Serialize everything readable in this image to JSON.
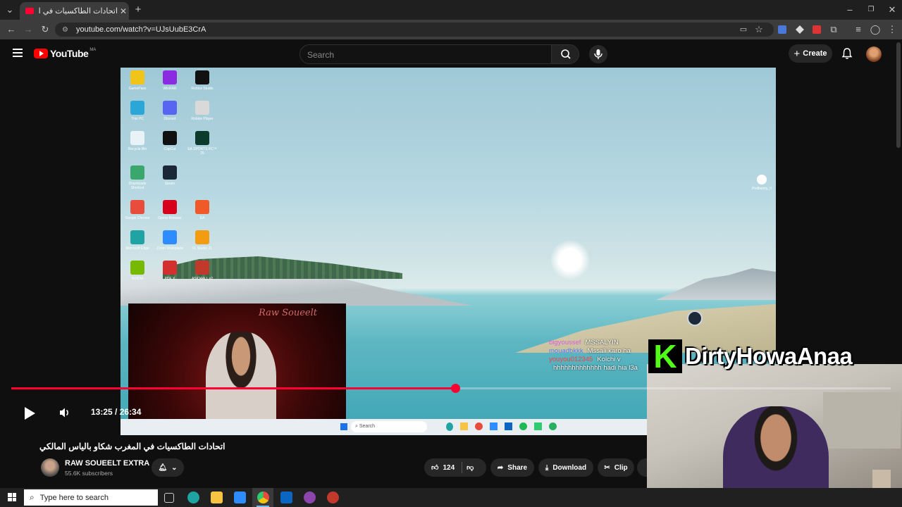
{
  "browser": {
    "tab_title": "اتحادات الطاكسيات في المغرب ...",
    "url": "youtube.com/watch?v=UJsUubE3CrA"
  },
  "youtube": {
    "logo_text": "YouTube",
    "country_code": "MA",
    "search_placeholder": "Search",
    "create_label": "Create"
  },
  "desktop": {
    "icons": [
      {
        "label": "GamePass",
        "color": "#f0c419"
      },
      {
        "label": "WinRAR",
        "color": "#8a2be2"
      },
      {
        "label": "Roblox Studio",
        "color": "#111111"
      },
      {
        "label": "This PC",
        "color": "#2aa7d8"
      },
      {
        "label": "Discord",
        "color": "#5865f2"
      },
      {
        "label": "Roblox Player",
        "color": "#d9d9d9"
      },
      {
        "label": "Recycle Bin",
        "color": "#e9f2f7"
      },
      {
        "label": "CapCut",
        "color": "#111111"
      },
      {
        "label": "EA SPORTS FC™ 25",
        "color": "#0c3b2e"
      },
      {
        "label": "Downloads Shortcut",
        "color": "#3aa76d"
      },
      {
        "label": "Steam",
        "color": "#1b2838"
      },
      {
        "label": "",
        "color": "transparent"
      },
      {
        "label": "Google Chrome",
        "color": "#e74c3c"
      },
      {
        "label": "Opera Browser",
        "color": "#d6001c"
      },
      {
        "label": "EA",
        "color": "#f05a28"
      },
      {
        "label": "Microsoft Edge",
        "color": "#1fa3a3"
      },
      {
        "label": "Zoom Workplace",
        "color": "#2d8cff"
      },
      {
        "label": "FL Studio 21",
        "color": "#f39c12"
      },
      {
        "label": "NVIDIA",
        "color": "#76b900"
      },
      {
        "label": "PDF X",
        "color": "#d32f2f"
      },
      {
        "label": "ASIO4ALL v2",
        "color": "#c0392b"
      }
    ],
    "right_icon_label": "Podbunny_II",
    "taskbar_search": "Search",
    "streamer_brand": "Raw Soueelt",
    "chat": [
      {
        "user": "bigyoussef",
        "msg": "MSSALYIN",
        "color": "#e05ad8"
      },
      {
        "user": "mouadbkkk",
        "msg": "Mssali karo ha",
        "color": "#4f7cff"
      },
      {
        "user": "youyou012345",
        "msg": "Kolchi v",
        "color": "#ff3b3b"
      },
      {
        "user": "",
        "msg": "hhhhhhhhhhhhh hadi hia l3a",
        "color": "#ffffff"
      }
    ]
  },
  "overlay": {
    "kick_letter": "K",
    "streamer_name": "DirtyHowaAnaa"
  },
  "player": {
    "current_time": "13:25",
    "duration": "26:34",
    "time_display": "13:25 / 26:34",
    "progress": 0.505
  },
  "video": {
    "title": "اتحادات الطاكسيات في المغرب شكاو بالياس المالكي",
    "channel": "RAW SOUEELT EXTRA",
    "subscribers": "55.6K subscribers",
    "likes": "124",
    "share_label": "Share",
    "download_label": "Download",
    "clip_label": "Clip"
  },
  "taskbar": {
    "search_placeholder": "Type here to search"
  }
}
